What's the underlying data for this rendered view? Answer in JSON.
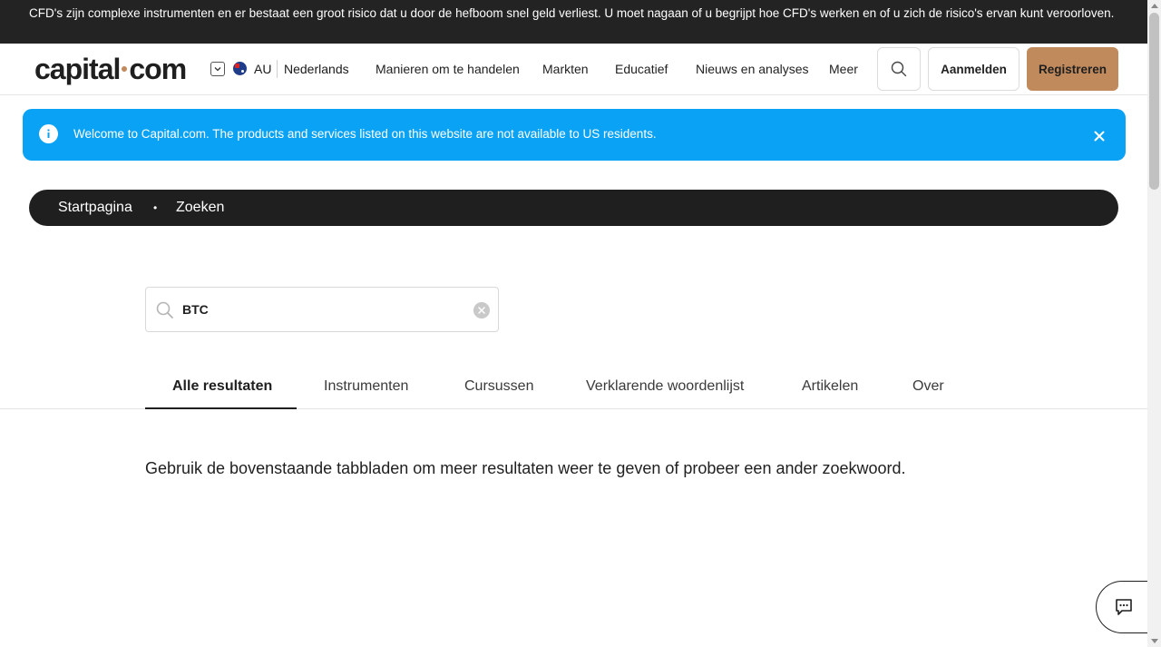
{
  "risk_warning": "CFD's zijn complexe instrumenten en er bestaat een groot risico dat u door de hefboom snel geld verliest. U moet nagaan of u begrijpt hoe CFD's werken en of u zich de risico's ervan kunt veroorloven.",
  "header": {
    "logo_left": "capital",
    "logo_right": "com",
    "region": "AU",
    "language": "Nederlands",
    "menu": [
      "Manieren om te handelen",
      "Markten",
      "Educatief",
      "Nieuws en analyses",
      "Meer"
    ],
    "login_label": "Aanmelden",
    "register_label": "Registreren"
  },
  "banner": {
    "text": "Welcome to Capital.com. The products and services listed on this website are not available to US residents."
  },
  "breadcrumb": {
    "home": "Startpagina",
    "separator": "•",
    "current": "Zoeken"
  },
  "search": {
    "value": "BTC"
  },
  "tabs": [
    {
      "label": "Alle resultaten",
      "active": true
    },
    {
      "label": "Instrumenten",
      "active": false
    },
    {
      "label": "Cursussen",
      "active": false
    },
    {
      "label": "Verklarende woordenlijst",
      "active": false
    },
    {
      "label": "Artikelen",
      "active": false
    },
    {
      "label": "Over",
      "active": false
    }
  ],
  "results_hint": "Gebruik de bovenstaande tabbladen om meer resultaten weer te geven of probeer een ander zoekwoord.",
  "colors": {
    "brand_accent": "#c08a5d",
    "banner_blue": "#0aa2f5",
    "dark": "#1f1f1f"
  },
  "icons": [
    "chevron-down-icon",
    "australia-flag-icon",
    "search-icon",
    "info-icon",
    "close-icon",
    "clear-icon",
    "chat-icon"
  ]
}
